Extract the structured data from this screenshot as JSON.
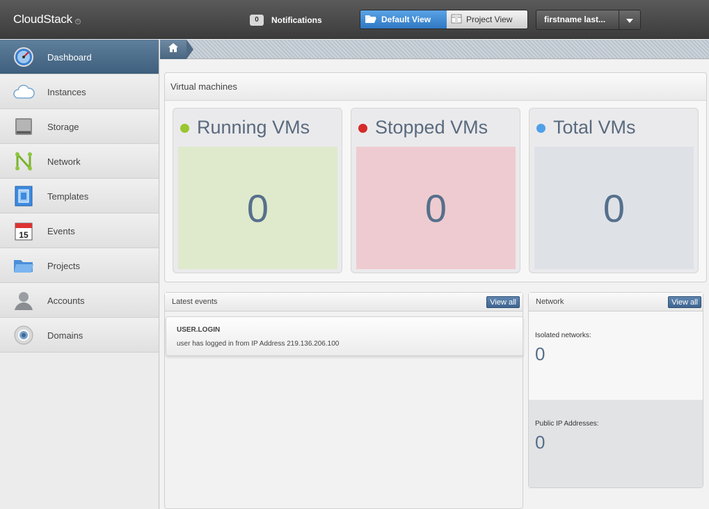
{
  "header": {
    "logo": "CloudStack",
    "logo_mark": "®",
    "notifications_count": "0",
    "notifications_label": "Notifications",
    "view_default": "Default View",
    "view_project": "Project View",
    "user_name": "firstname last..."
  },
  "sidebar": {
    "items": [
      {
        "label": "Dashboard",
        "icon": "dashboard-icon",
        "active": true
      },
      {
        "label": "Instances",
        "icon": "cloud-icon"
      },
      {
        "label": "Storage",
        "icon": "storage-icon"
      },
      {
        "label": "Network",
        "icon": "network-icon"
      },
      {
        "label": "Templates",
        "icon": "templates-icon"
      },
      {
        "label": "Events",
        "icon": "calendar-icon"
      },
      {
        "label": "Projects",
        "icon": "folder-icon"
      },
      {
        "label": "Accounts",
        "icon": "user-icon"
      },
      {
        "label": "Domains",
        "icon": "domains-icon"
      }
    ]
  },
  "calendar_day": "15",
  "vm": {
    "heading": "Virtual machines",
    "cards": [
      {
        "title": "Running VMs",
        "value": "0",
        "dot_color": "#9ac630",
        "box_color": "#dfe9cc"
      },
      {
        "title": "Stopped VMs",
        "value": "0",
        "dot_color": "#d62a2a",
        "box_color": "#eecbd0"
      },
      {
        "title": "Total VMs",
        "value": "0",
        "dot_color": "#4fa0e8",
        "box_color": "#dee2e7"
      }
    ]
  },
  "events": {
    "heading": "Latest events",
    "view_all": "View all",
    "items": [
      {
        "title": "USER.LOGIN",
        "description": "user has logged in from IP Address 219.136.206.100"
      }
    ]
  },
  "network": {
    "heading": "Network",
    "view_all": "View all",
    "isolated_label": "Isolated networks:",
    "isolated_value": "0",
    "public_ip_label": "Public IP Addresses:",
    "public_ip_value": "0"
  }
}
